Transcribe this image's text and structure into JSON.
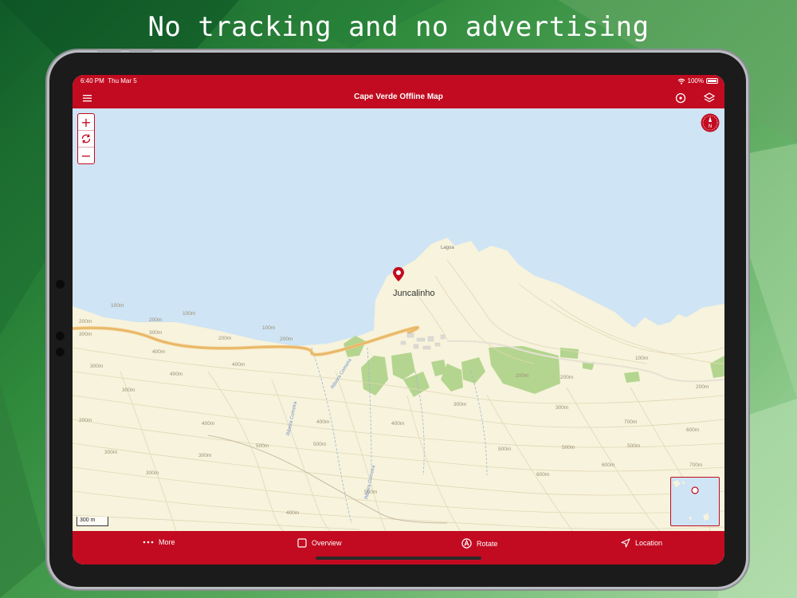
{
  "headline": "No tracking and no advertising",
  "status_bar": {
    "time": "6:40 PM",
    "date": "Thu Mar 5",
    "battery": "100%"
  },
  "nav": {
    "title": "Cape Verde Offline Map",
    "menu_icon": "hamburger-icon",
    "locate_icon": "target-icon",
    "layers_icon": "layers-icon"
  },
  "map": {
    "place_label": "Juncalinho",
    "beach_label": "Lagoa",
    "scale": "300 m",
    "contours": [
      "100m",
      "100m",
      "100m",
      "100m",
      "200m",
      "200m",
      "200m",
      "200m",
      "200m",
      "200m",
      "200m",
      "200m",
      "300m",
      "300m",
      "300m",
      "300m",
      "300m",
      "300m",
      "300m",
      "300m",
      "300m",
      "400m",
      "400m",
      "400m",
      "400m",
      "400m",
      "400m",
      "400m",
      "500m",
      "500m",
      "500m",
      "500m",
      "500m",
      "500m",
      "600m",
      "600m",
      "600m",
      "700m",
      "700m",
      "800m"
    ],
    "streams": [
      "Ribeira Comeira",
      "Ribeira Comeira",
      "Ribeira Comeira"
    ],
    "zoom_in": "+",
    "zoom_out": "−",
    "compass_letter": "N"
  },
  "tabs": [
    {
      "label": "More",
      "icon": "more-dots-icon"
    },
    {
      "label": "Overview",
      "icon": "square-icon"
    },
    {
      "label": "Rotate",
      "icon": "compass-a-icon"
    },
    {
      "label": "Location",
      "icon": "location-arrow-icon"
    }
  ],
  "colors": {
    "brand_red": "#c20b20",
    "sea": "#cfe4f4",
    "land": "#f7f3dc",
    "forest": "#b4d58f",
    "road": "#f1c47a"
  }
}
